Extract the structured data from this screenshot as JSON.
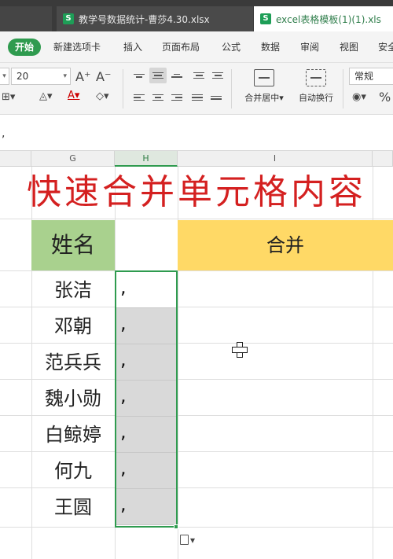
{
  "tabs": [
    {
      "label": "教学号数据统计-曹莎4.30.xlsx",
      "icon": "S"
    },
    {
      "label": "excel表格模板(1)(1).xls",
      "icon": "S"
    }
  ],
  "menu": {
    "start": "开始",
    "items": [
      "新建选项卡",
      "插入",
      "页面布局",
      "公式",
      "数据",
      "审阅",
      "视图",
      "安全"
    ]
  },
  "ribbon": {
    "font_size": "20",
    "grow_font": "A⁺",
    "shrink_font": "A⁻",
    "merge_center": "合并居中",
    "wrap_text": "自动换行",
    "number_format": "常规",
    "percent": "%"
  },
  "formula_bar": {
    "content": ","
  },
  "columns": [
    {
      "label": "G"
    },
    {
      "label": "H",
      "selected": true
    },
    {
      "label": "I"
    }
  ],
  "sheet": {
    "title": "快速合并单元格内容",
    "header_name": "姓名",
    "header_merge": "合并",
    "names": [
      "张洁",
      "邓朝",
      "范兵兵",
      "魏小勋",
      "白鲸婷",
      "何九",
      "王圆"
    ],
    "h_values": [
      ",",
      ",",
      ",",
      ",",
      ",",
      ",",
      ","
    ]
  },
  "colors": {
    "title_red": "#d42020",
    "header_green": "#a9d18e",
    "header_yellow": "#ffd966",
    "selection_green": "#2f9b4f"
  }
}
